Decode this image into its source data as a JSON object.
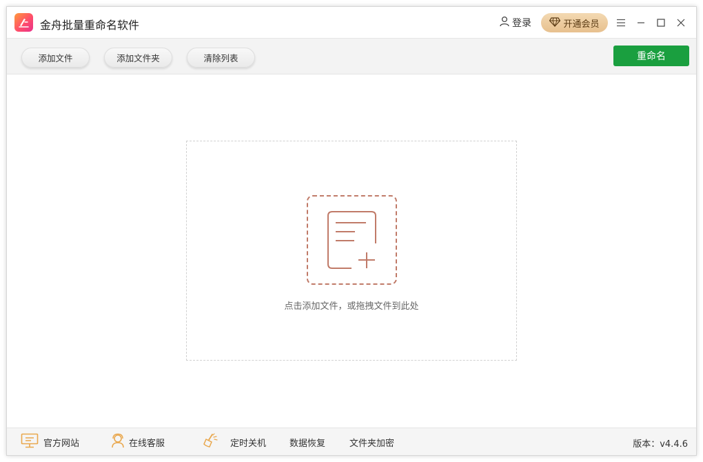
{
  "app": {
    "title": "金舟批量重命名软件",
    "login_label": "登录",
    "vip_label": "开通会员"
  },
  "toolbar": {
    "add_file": "添加文件",
    "add_folder": "添加文件夹",
    "clear_list": "清除列表",
    "rename": "重命名"
  },
  "dropzone": {
    "hint": "点击添加文件，或拖拽文件到此处"
  },
  "footer": {
    "website": "官方网站",
    "support": "在线客服",
    "shutdown": "定时关机",
    "recovery": "数据恢复",
    "encrypt": "文件夹加密",
    "version": "版本：v4.4.6"
  },
  "icons": {
    "app": "app-logo-icon",
    "login": "user-icon",
    "vip": "diamond-icon",
    "menu": "menu-icon",
    "minimize": "minimize-icon",
    "maximize": "maximize-icon",
    "close": "close-icon",
    "add_file": "add-file-icon",
    "website": "monitor-icon",
    "support": "headset-user-icon",
    "shutdown": "broom-icon"
  },
  "colors": {
    "primary_green": "#1a9f3f",
    "accent_brown": "#c07a68",
    "icon_orange": "#e9a74d",
    "vip_gold": "#e7c08e"
  }
}
